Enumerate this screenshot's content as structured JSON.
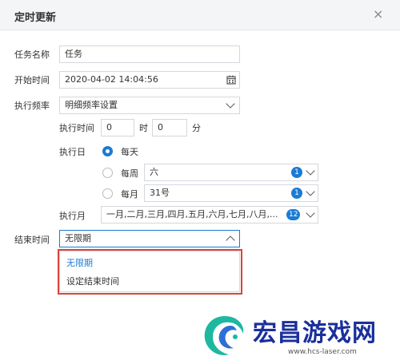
{
  "dialog": {
    "title": "定时更新",
    "close_glyph": "×"
  },
  "task_name": {
    "label": "任务名称",
    "value": "任务"
  },
  "start_time": {
    "label": "开始时间",
    "value": "2020-04-02 14:04:56"
  },
  "frequency": {
    "label": "执行频率",
    "value": "明细频率设置",
    "exec_time": {
      "label": "执行时间",
      "hour_value": "0",
      "hour_unit": "时",
      "minute_value": "0",
      "minute_unit": "分"
    },
    "exec_day": {
      "label": "执行日",
      "options": [
        {
          "label": "每天",
          "selected": true
        },
        {
          "label": "每周",
          "value": "六",
          "count": "1",
          "selected": false
        },
        {
          "label": "每月",
          "value": "31号",
          "count": "1",
          "selected": false
        }
      ]
    },
    "exec_month": {
      "label": "执行月",
      "value": "一月,二月,三月,四月,五月,六月,七月,八月,...",
      "count": "12"
    }
  },
  "end_time": {
    "label": "结束时间",
    "value": "无限期",
    "options": [
      "无限期",
      "设定结束时间"
    ]
  },
  "watermark": {
    "name": "宏昌游戏网",
    "url": "www.hcs-laser.com"
  },
  "colors": {
    "accent": "#1a7bd5",
    "highlight": "#d9443a",
    "header_bg": "#f4f5f7"
  }
}
